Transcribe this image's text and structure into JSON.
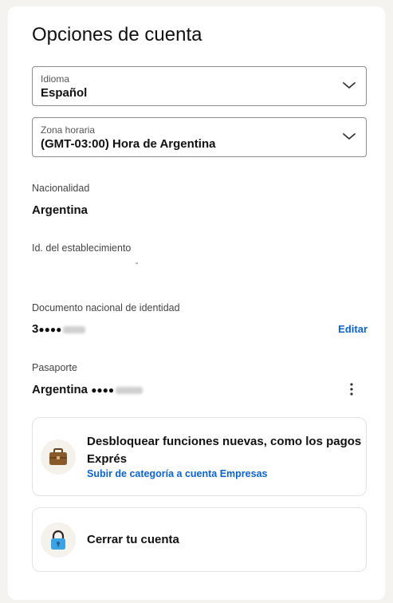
{
  "page": {
    "title": "Opciones de cuenta"
  },
  "language": {
    "label": "Idioma",
    "value": "Español"
  },
  "timezone": {
    "label": "Zona horaria",
    "value": "(GMT-03:00) Hora de Argentina"
  },
  "nationality": {
    "label": "Nacionalidad",
    "value": "Argentina"
  },
  "establishment": {
    "label": "Id. del establecimiento"
  },
  "national_id": {
    "label": "Documento nacional de identidad",
    "prefix": "3",
    "dots": "●●●●",
    "edit_label": "Editar"
  },
  "passport": {
    "label": "Pasaporte",
    "country": "Argentina",
    "dots": "●●●●"
  },
  "unlock_card": {
    "title": "Desbloquear funciones nuevas, como los pagos Exprés",
    "link": "Subir de categoría a cuenta Empresas",
    "icon": "briefcase-icon"
  },
  "close_card": {
    "title": "Cerrar tu cuenta",
    "icon": "lock-icon"
  },
  "colors": {
    "link": "#0b63ce",
    "background": "#f5f3ef",
    "card": "#ffffff",
    "briefcase": "#8a5a2b",
    "lock": "#3aa3e3"
  }
}
